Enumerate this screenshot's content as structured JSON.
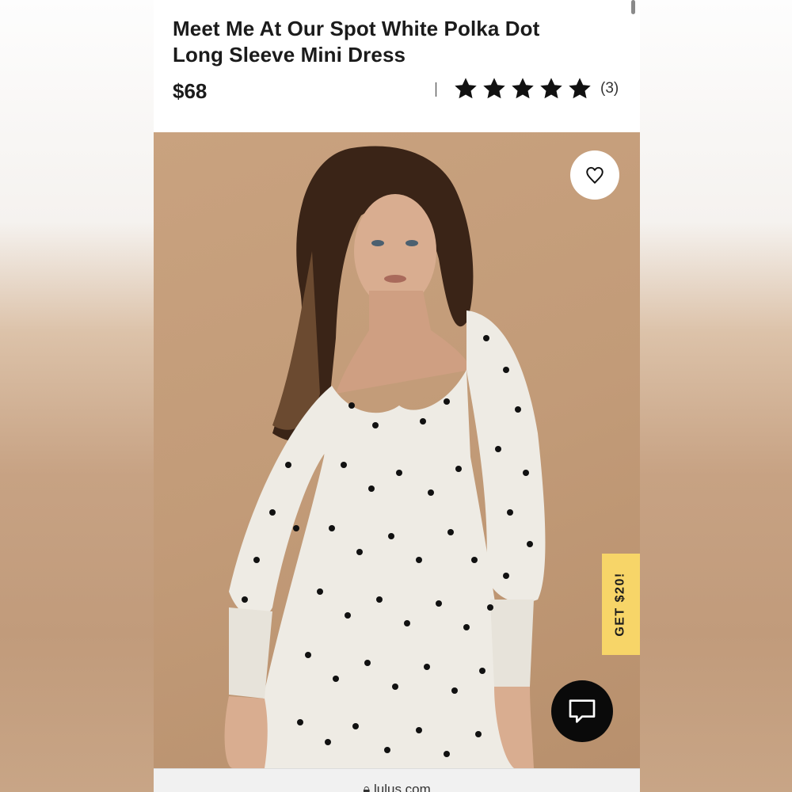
{
  "product": {
    "title_line1": "Meet Me At Our Spot White Polka Dot",
    "title_line2": "Long Sleeve Mini Dress",
    "price": "$68",
    "rating_stars": 5,
    "review_count": "(3)"
  },
  "overlays": {
    "promo_tab": "GET $20!",
    "wishlist_icon": "heart-icon",
    "chat_icon": "chat-bubble-icon"
  },
  "browser": {
    "url": "lulus.com"
  },
  "colors": {
    "promo": "#f7d568",
    "background_image": "#c29b78",
    "text": "#1b1b1b"
  }
}
